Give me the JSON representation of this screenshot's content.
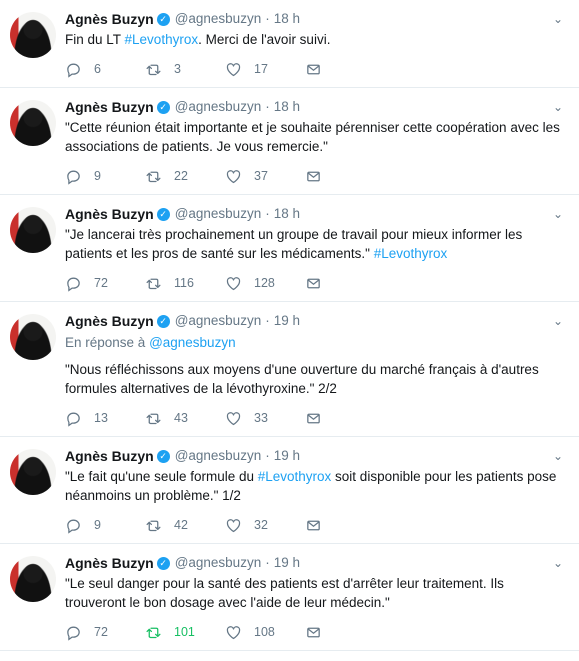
{
  "colors": {
    "link": "#1da1f2",
    "muted": "#657786",
    "retweeted": "#17bf63",
    "border": "#e6ecf0"
  },
  "tweets": [
    {
      "name": "Agnès Buzyn",
      "handle": "@agnesbuzyn",
      "time": "18 h",
      "text_before": "Fin du LT ",
      "hashtag": "#Levothyrox",
      "text_after": ". Merci de l'avoir suivi.",
      "replies": "6",
      "retweets": "3",
      "likes": "17"
    },
    {
      "name": "Agnès Buzyn",
      "handle": "@agnesbuzyn",
      "time": "18 h",
      "text_before": "\"Cette réunion était importante et je souhaite pérenniser cette coopération avec les associations de patients. Je vous remercie.\"",
      "hashtag": "",
      "text_after": "",
      "replies": "9",
      "retweets": "22",
      "likes": "37"
    },
    {
      "name": "Agnès Buzyn",
      "handle": "@agnesbuzyn",
      "time": "18 h",
      "text_before": "\"Je lancerai très prochainement un groupe de travail pour mieux informer les patients et les pros de santé sur les médicaments.\" ",
      "hashtag": "#Levothyrox",
      "text_after": "",
      "replies": "72",
      "retweets": "116",
      "likes": "128"
    },
    {
      "name": "Agnès Buzyn",
      "handle": "@agnesbuzyn",
      "time": "19 h",
      "reply_to_label": "En réponse à ",
      "reply_to_mention": "@agnesbuzyn",
      "text_before": "\"Nous réfléchissons aux moyens d'une ouverture du marché français à d'autres formules alternatives de la lévothyroxine.\" 2/2",
      "hashtag": "",
      "text_after": "",
      "replies": "13",
      "retweets": "43",
      "likes": "33"
    },
    {
      "name": "Agnès Buzyn",
      "handle": "@agnesbuzyn",
      "time": "19 h",
      "text_before": "\"Le fait qu'une seule formule du ",
      "hashtag": "#Levothyrox",
      "text_after": " soit disponible pour les patients pose néanmoins un problème.\" 1/2",
      "replies": "9",
      "retweets": "42",
      "likes": "32"
    },
    {
      "name": "Agnès Buzyn",
      "handle": "@agnesbuzyn",
      "time": "19 h",
      "text_before": "\"Le seul danger pour la santé des patients est d'arrêter leur traitement. Ils trouveront le bon dosage avec l'aide de leur médecin.\"",
      "hashtag": "",
      "text_after": "",
      "replies": "72",
      "retweets": "101",
      "likes": "108",
      "retweeted": true
    }
  ]
}
